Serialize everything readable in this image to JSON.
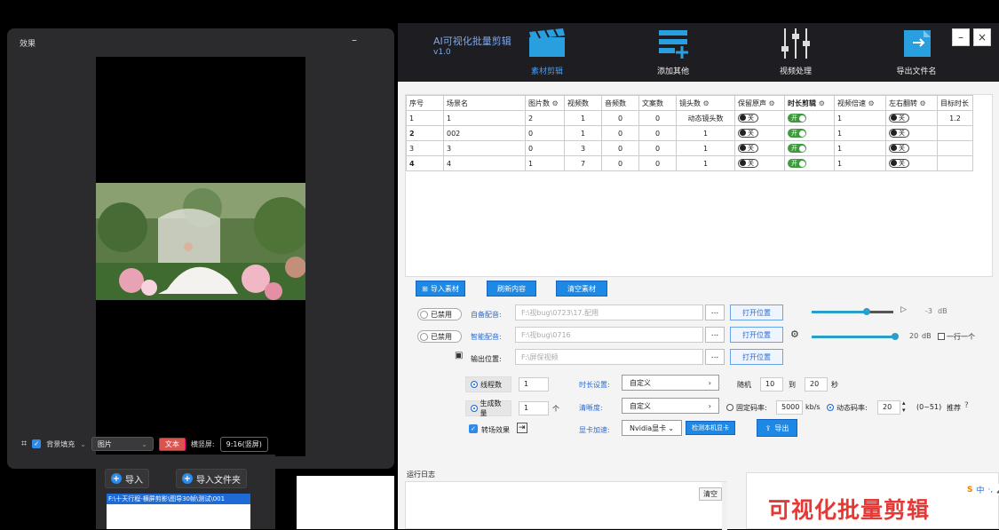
{
  "effect": {
    "title": "效果",
    "minimize": "–",
    "bg_fill_label": "背景填充",
    "image_select": "图片",
    "text_tag": "文本",
    "orientation_label": "横竖屏:",
    "ratio": "9:16(竖屏)"
  },
  "import_popup": {
    "import_label": "导入",
    "import_folder_label": "导入文件夹",
    "selected_path": "F:\\十天行程-横屏剪影\\图导30帧\\测试\\001"
  },
  "app": {
    "title": "AI可视化批量剪辑",
    "version": "v1.0",
    "toolbar": [
      {
        "label": "素材剪辑",
        "icon": "clapper-icon",
        "active": true
      },
      {
        "label": "添加其他",
        "icon": "add-list-icon",
        "active": false
      },
      {
        "label": "视频处理",
        "icon": "sliders-icon",
        "active": false
      },
      {
        "label": "导出文件名",
        "icon": "export-file-icon",
        "active": false
      }
    ],
    "minimize": "–",
    "close": "×"
  },
  "grid": {
    "headers": [
      "序号",
      "场景名",
      "图片数",
      "视频数",
      "音频数",
      "文案数",
      "镜头数",
      "保留原声",
      "时长剪辑",
      "视频倍速",
      "左右翻转",
      "目标时长"
    ],
    "rows": [
      {
        "idx": "1",
        "name": "1",
        "images": "2",
        "videos": "1",
        "audio": "0",
        "copy": "0",
        "shots": "动态镜头数",
        "keep_audio": "关",
        "trim": "开",
        "speed": "1",
        "flip": "关",
        "target": "1.2"
      },
      {
        "idx": "2",
        "name": "002",
        "images": "0",
        "videos": "1",
        "audio": "0",
        "copy": "0",
        "shots": "1",
        "keep_audio": "关",
        "trim": "开",
        "speed": "1",
        "flip": "关",
        "target": ""
      },
      {
        "idx": "3",
        "name": "3",
        "images": "0",
        "videos": "3",
        "audio": "0",
        "copy": "0",
        "shots": "1",
        "keep_audio": "关",
        "trim": "开",
        "speed": "1",
        "flip": "关",
        "target": ""
      },
      {
        "idx": "4",
        "name": "4",
        "images": "1",
        "videos": "7",
        "audio": "0",
        "copy": "0",
        "shots": "1",
        "keep_audio": "关",
        "trim": "开",
        "speed": "1",
        "flip": "关",
        "target": ""
      }
    ]
  },
  "actions": {
    "import": "导入素材",
    "refresh": "刷新内容",
    "clear": "清空素材"
  },
  "audio": {
    "disabled1": "已禁用",
    "self_dub_label": "自备配音:",
    "self_dub_path": "F:\\视bug\\0723\\17.配用",
    "disabled2": "已禁用",
    "smart_dub_label": "智能配音:",
    "smart_dub_path": "F:\\视bug\\0716",
    "dots": "...",
    "open_location": "打开位置",
    "vol1": "-3",
    "vol2": "20",
    "db": "dB",
    "one_line_label": "一行一个"
  },
  "output": {
    "label": "输出位置:",
    "path": "F:\\屏保视频",
    "dots": "...",
    "open_location": "打开位置"
  },
  "settings": {
    "threads_label": "线程数",
    "threads": "1",
    "gen_count_label": "生成数量",
    "gen_count": "1",
    "gen_unit": "个",
    "transition_label": "转场效果",
    "duration_label": "时长设置:",
    "duration_mode": "自定义",
    "random_label": "随机",
    "rand_min": "10",
    "to_label": "到",
    "rand_max": "20",
    "sec_label": "秒",
    "resolution_label": "清晰度:",
    "resolution_mode": "自定义",
    "fixed_rate_label": "固定码率:",
    "fixed_rate": "5000",
    "kbs": "kb/s",
    "dynamic_rate_label": "动态码率:",
    "dynamic_rate": "20",
    "range_hint": "(0~51)",
    "recommend": "推荐",
    "gpu_label": "显卡加速:",
    "gpu_value": "Nvidia显卡",
    "detect_gpu": "检测本机显卡",
    "export": "导出"
  },
  "log": {
    "label": "运行日志",
    "clear": "清空"
  },
  "brand": {
    "text": "可视化批量剪辑",
    "ime_s": "S",
    "ime_zh": "中",
    "ime_punct": "·,",
    "ime_mic": "🎤"
  }
}
